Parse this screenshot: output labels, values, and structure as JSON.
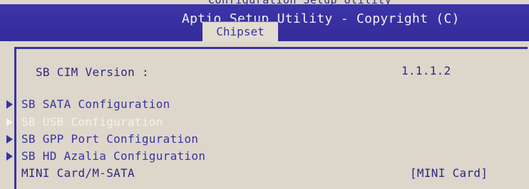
{
  "top_fragment": "Configuration Setup Utility",
  "header": {
    "title": "Aptio Setup Utility - Copyright (C)",
    "active_tab": "Chipset"
  },
  "info": {
    "label": "SB CIM Version :",
    "value": "1.1.1.2"
  },
  "menu": [
    {
      "label": "SB SATA Configuration",
      "selected": false
    },
    {
      "label": "SB USB Configuration",
      "selected": true
    },
    {
      "label": "SB GPP Port Configuration",
      "selected": false
    },
    {
      "label": "SB HD Azalia Configuration",
      "selected": false
    }
  ],
  "setting": {
    "label": "MINI Card/M-SATA",
    "value": "[MINI Card]"
  },
  "colors": {
    "header_bg": "#3c34a8",
    "text_blue": "#2e2a7c",
    "selected_text": "#f4f2ea",
    "screen_bg": "#dcd6cb"
  }
}
